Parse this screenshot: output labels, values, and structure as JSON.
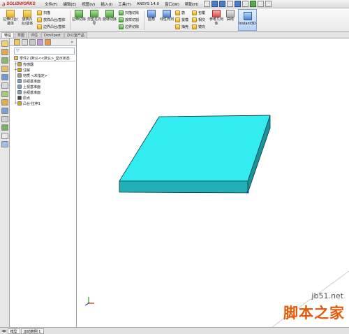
{
  "app": {
    "logo_text": "SOLIDWORKS",
    "menu": [
      "文件(F)",
      "编辑(E)",
      "视图(V)",
      "插入(I)",
      "工具(T)",
      "ANSYS 14.0",
      "窗口(W)",
      "帮助(H)"
    ]
  },
  "ribbon": {
    "boss_extrude": "拉伸凸台/基体",
    "revolve_boss": "旋转凸台/基体",
    "sweep": "扫描",
    "loft": "放样凸台/基体",
    "boundary_boss": "边界凸台/基体",
    "extruded_cut": "拉伸切除",
    "hole_wizard": "异型孔向导",
    "revolved_cut": "旋转切除",
    "swept_cut": "扫描切除",
    "lofted_cut": "放样切割",
    "boundary_cut": "边界切除",
    "fillet": "圆角",
    "linear_pattern": "线性阵列",
    "rib": "筋",
    "draft": "拔模",
    "wrap": "包覆",
    "intersect": "相交",
    "shell": "抽壳",
    "mirror": "镜向",
    "ref_geometry": "参考几何体",
    "curves": "曲线",
    "instant3d": "Instant3D"
  },
  "command_tabs": [
    "特征",
    "草图",
    "评估",
    "DimXpert",
    "办公室产品"
  ],
  "feature_tree": {
    "root": "零件2 (默认<<默认>_显示状态",
    "items": [
      {
        "label": "传感器",
        "icon": "sensor-icon",
        "color": "#d9a02a"
      },
      {
        "label": "注解",
        "icon": "annotations-icon",
        "color": "#d9a02a"
      },
      {
        "label": "材质 <未指定>",
        "icon": "material-icon",
        "color": "#999999"
      },
      {
        "label": "前视基准面",
        "icon": "plane-icon",
        "color": "#7a9bd0"
      },
      {
        "label": "上视基准面",
        "icon": "plane-icon",
        "color": "#7a9bd0"
      },
      {
        "label": "右视基准面",
        "icon": "plane-icon",
        "color": "#7a9bd0"
      },
      {
        "label": "原点",
        "icon": "origin-icon",
        "color": "#444444"
      },
      {
        "label": "凸台-拉伸1",
        "icon": "extrude-icon",
        "color": "#d9a02a"
      }
    ]
  },
  "bottom_tabs": [
    "模型",
    "运动算例 1"
  ],
  "model": {
    "face_top": "#33ecf0",
    "face_front": "#22b0b4",
    "face_right": "#1a9498",
    "edge": "#0b3a3c"
  },
  "watermark": {
    "site": "jb51.net",
    "name": "脚本之家"
  }
}
